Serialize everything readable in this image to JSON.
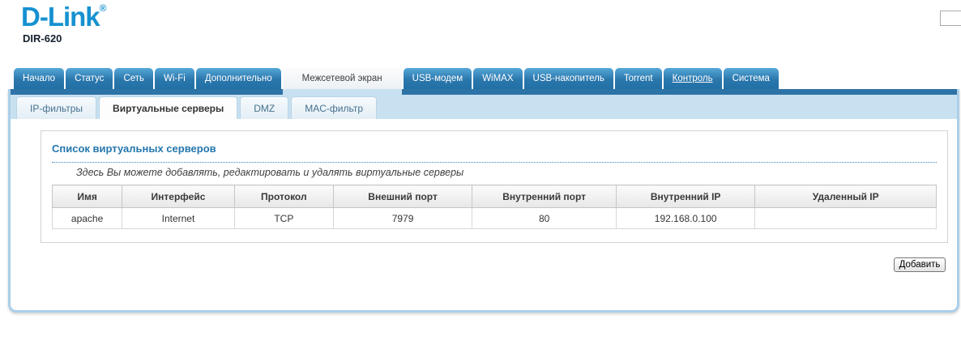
{
  "brand": {
    "logo_text": "D-Link",
    "registered_mark": "®",
    "model": "DIR-620"
  },
  "main_tabs": [
    {
      "label": "Начало"
    },
    {
      "label": "Статус"
    },
    {
      "label": "Сеть"
    },
    {
      "label": "Wi-Fi"
    },
    {
      "label": "Дополнительно"
    },
    {
      "label": "Межсетевой экран",
      "active": true
    },
    {
      "label": "USB-модем"
    },
    {
      "label": "WiMAX"
    },
    {
      "label": "USB-накопитель"
    },
    {
      "label": "Torrent"
    },
    {
      "label": "Контроль",
      "underlined": true
    },
    {
      "label": "Система"
    }
  ],
  "sub_tabs": [
    {
      "label": "IP-фильтры"
    },
    {
      "label": "Виртуальные серверы",
      "active": true
    },
    {
      "label": "DMZ"
    },
    {
      "label": "MAC-фильтр"
    }
  ],
  "content": {
    "section_title": "Список виртуальных серверов",
    "description": "Здесь Вы можете добавлять, редактировать и удалять виртуальные серверы",
    "table": {
      "headers": [
        "Имя",
        "Интерфейс",
        "Протокол",
        "Внешний порт",
        "Внутренний порт",
        "Внутренний IP",
        "Удаленный IP"
      ],
      "rows": [
        [
          "apache",
          "Internet",
          "TCP",
          "7979",
          "80",
          "192.168.0.100",
          ""
        ]
      ]
    },
    "add_button_label": "Добавить"
  },
  "colors": {
    "tab_blue": "#2b77ac",
    "tab_blue_light": "#55a7d8",
    "active_tab_bg": "#eff2f5",
    "subtab_band": "#c8e1f1",
    "tab_strip": "#2d73a7",
    "panel_border": "#abcfe9",
    "heading_blue": "#2577ad",
    "logo_blue": "#1691d0"
  }
}
